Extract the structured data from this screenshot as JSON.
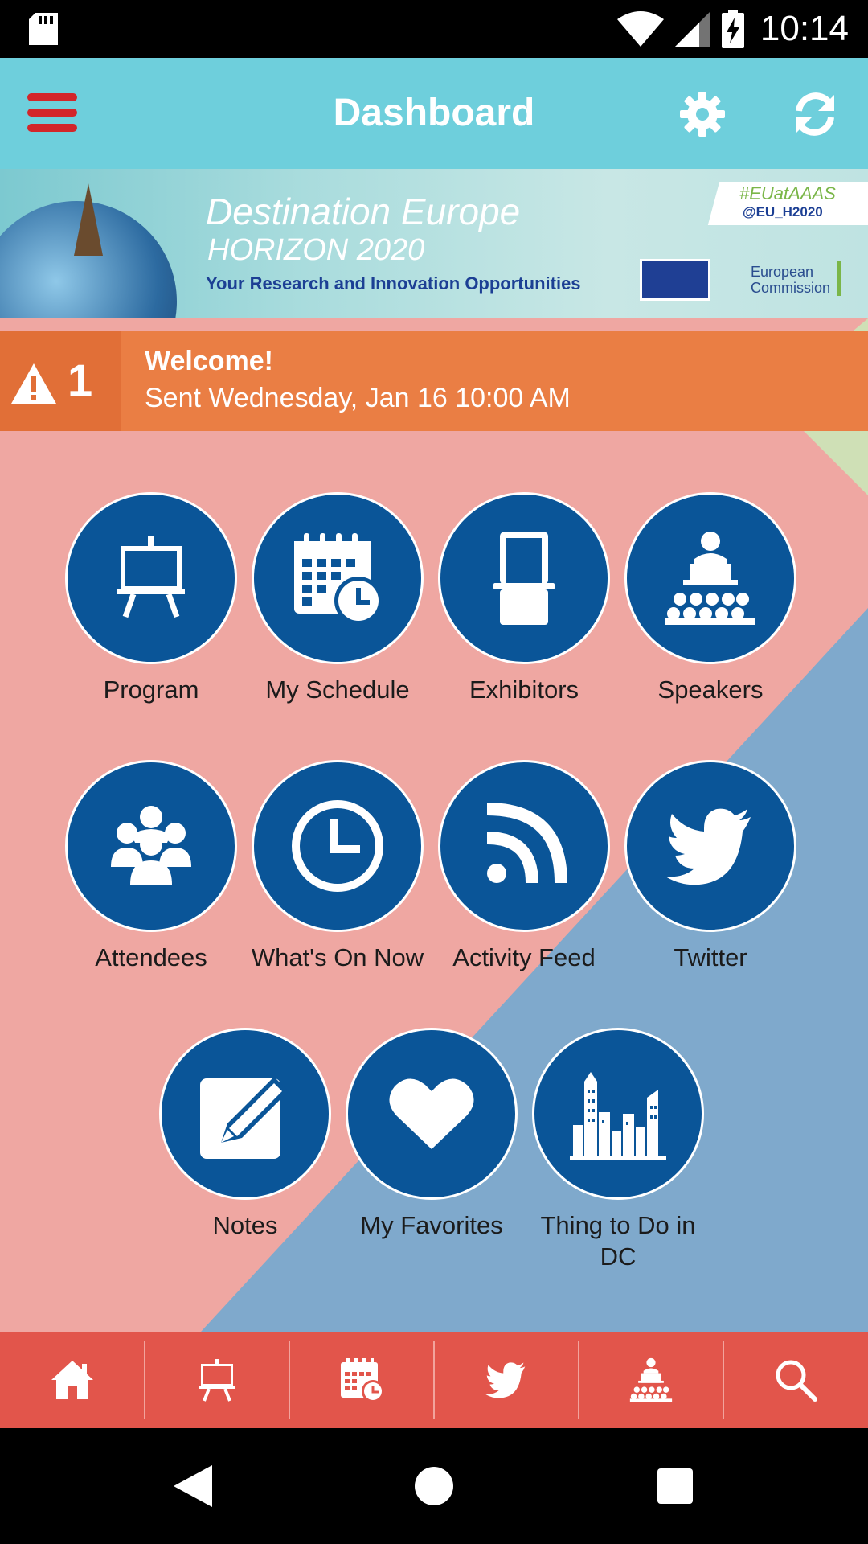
{
  "status_bar": {
    "time": "10:14"
  },
  "app_bar": {
    "title": "Dashboard"
  },
  "banner": {
    "title": "Destination Europe",
    "subtitle": "HORIZON 2020",
    "tagline": "Your Research and Innovation Opportunities",
    "hashtag": "#EUatAAAS",
    "handle": "@EU_H2020",
    "org_line1": "European",
    "org_line2": "Commission"
  },
  "alert": {
    "count": "1",
    "title": "Welcome!",
    "subtitle": "Sent Wednesday, Jan 16 10:00 AM"
  },
  "tiles": [
    {
      "label": "Program",
      "icon": "presentation-board-icon"
    },
    {
      "label": "My Schedule",
      "icon": "calendar-clock-icon"
    },
    {
      "label": "Exhibitors",
      "icon": "booth-icon"
    },
    {
      "label": "Speakers",
      "icon": "speaker-podium-icon"
    },
    {
      "label": "Attendees",
      "icon": "people-group-icon"
    },
    {
      "label": "What's On Now",
      "icon": "clock-icon"
    },
    {
      "label": "Activity Feed",
      "icon": "rss-icon"
    },
    {
      "label": "Twitter",
      "icon": "twitter-bird-icon"
    },
    {
      "label": "Notes",
      "icon": "notes-pencil-icon"
    },
    {
      "label": "My Favorites",
      "icon": "heart-icon"
    },
    {
      "label": "Thing to Do in DC",
      "icon": "city-skyline-icon"
    }
  ],
  "bottom_nav": [
    {
      "icon": "home-icon"
    },
    {
      "icon": "presentation-board-icon"
    },
    {
      "icon": "calendar-clock-icon"
    },
    {
      "icon": "twitter-bird-icon"
    },
    {
      "icon": "speaker-podium-icon"
    },
    {
      "icon": "search-icon"
    }
  ],
  "colors": {
    "app_bar": "#6ecfdc",
    "alert": "#ea7e44",
    "tile": "#0a5598",
    "bottom_nav": "#e2554b",
    "menu_accent": "#d2262a"
  }
}
